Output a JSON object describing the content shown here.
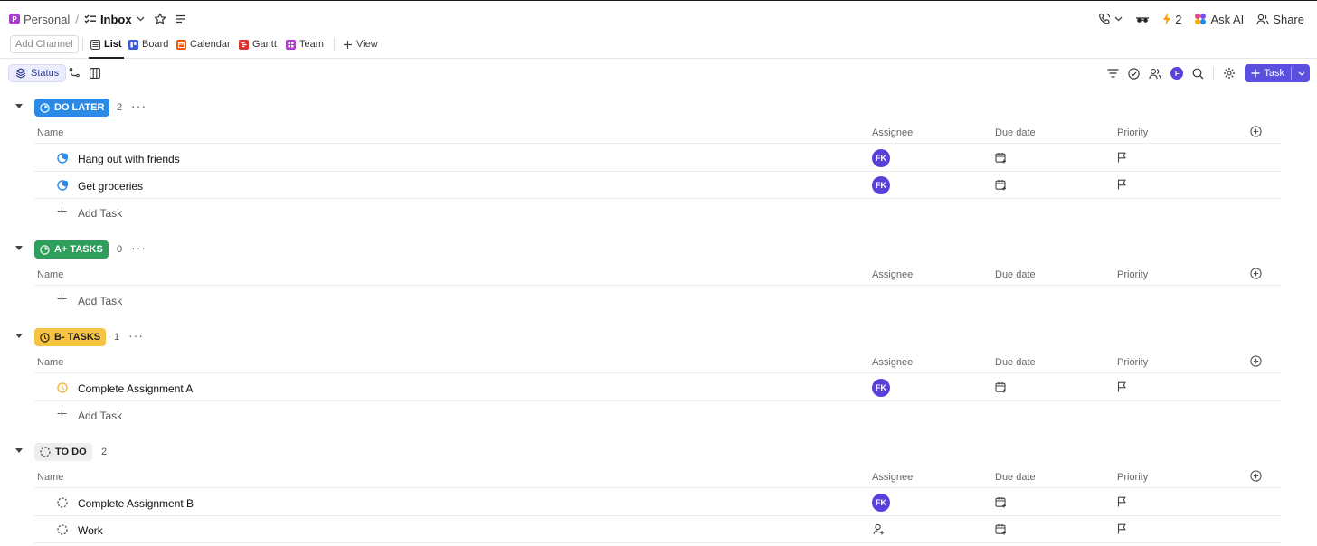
{
  "breadcrumb": {
    "space_initial": "P",
    "space": "Personal",
    "separator": "/",
    "current": "Inbox"
  },
  "top_right": {
    "notifications_count": "2",
    "ask_ai": "Ask AI",
    "share": "Share"
  },
  "viewbar": {
    "add_channel": "Add Channel",
    "tabs": [
      {
        "label": "List",
        "color": "#555555",
        "active": true
      },
      {
        "label": "Board",
        "color": "#3b5bdb"
      },
      {
        "label": "Calendar",
        "color": "#e8590c"
      },
      {
        "label": "Gantt",
        "color": "#e03131"
      },
      {
        "label": "Team",
        "color": "#ae3ec9"
      }
    ],
    "add_view": "View"
  },
  "toolbar": {
    "status_chip": "Status",
    "avatar_initial": "F",
    "new_task": "Task"
  },
  "columns": {
    "name": "Name",
    "assignee": "Assignee",
    "due_date": "Due date",
    "priority": "Priority"
  },
  "add_task_label": "Add Task",
  "groups": [
    {
      "label": "DO LATER",
      "count": "2",
      "bg": "#2b8ae6",
      "fg": "#ffffff",
      "tasks": [
        {
          "name": "Hang out with friends",
          "assignee": "FK"
        },
        {
          "name": "Get groceries",
          "assignee": "FK"
        }
      ]
    },
    {
      "label": "A+ TASKS",
      "count": "0",
      "bg": "#2e9e5b",
      "fg": "#ffffff",
      "tasks": []
    },
    {
      "label": "B- TASKS",
      "count": "1",
      "bg": "#f6c343",
      "fg": "#1f1f1f",
      "tasks": [
        {
          "name": "Complete Assignment A",
          "assignee": "FK"
        }
      ]
    },
    {
      "label": "TO DO",
      "count": "2",
      "bg": "#eeeeee",
      "fg": "#1f1f1f",
      "tasks": [
        {
          "name": "Complete Assignment B",
          "assignee": "FK"
        },
        {
          "name": "Work",
          "assignee": ""
        }
      ]
    }
  ]
}
